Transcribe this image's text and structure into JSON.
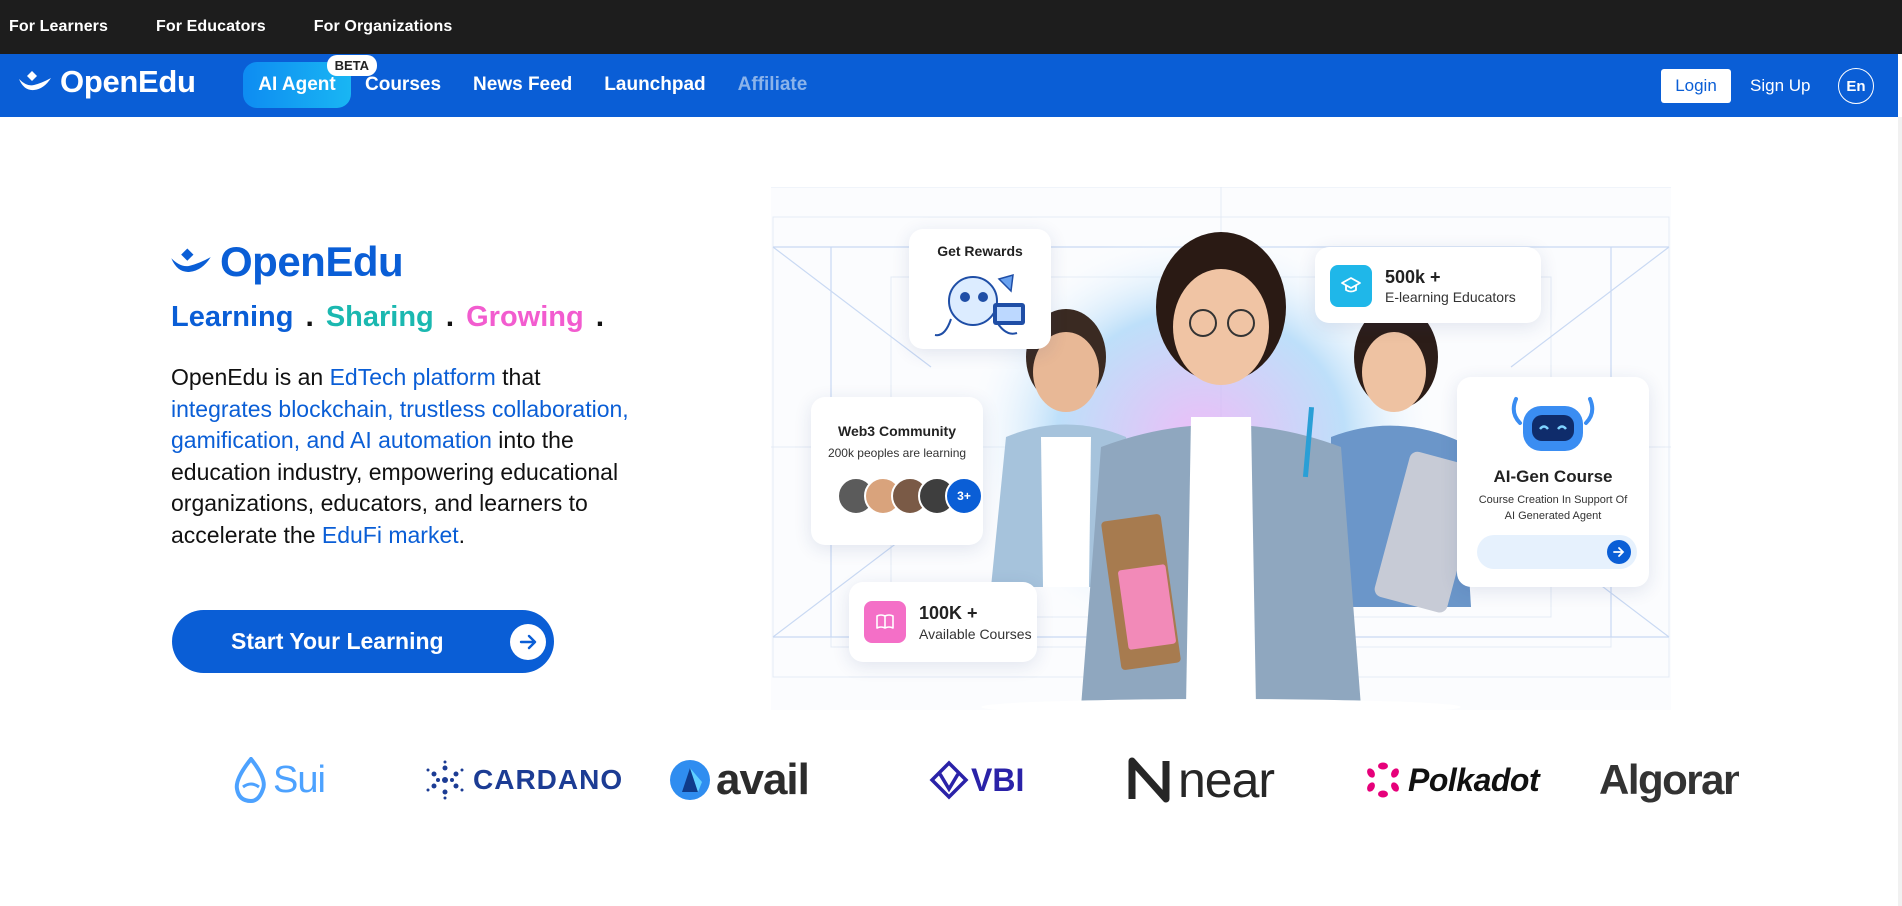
{
  "topbar": {
    "links": [
      "For Learners",
      "For Educators",
      "For Organizations"
    ]
  },
  "nav": {
    "brand": "OpenEdu",
    "ai_agent": "AI Agent",
    "beta": "BETA",
    "links": [
      "Courses",
      "News Feed",
      "Launchpad",
      "Affiliate"
    ],
    "login": "Login",
    "signup": "Sign Up",
    "language": "En"
  },
  "hero": {
    "brand": "OpenEdu",
    "tagline": [
      "Learning",
      "Sharing",
      "Growing"
    ],
    "tagline_dot": ".",
    "description": {
      "p1": "OpenEdu is an ",
      "h1": "EdTech platform",
      "p2": " that ",
      "h2": "integrates blockchain, trustless collaboration, gamification, and AI automation",
      "p3": " into the education industry, empowering educational organizations, educators, and learners to accelerate the ",
      "h3": "EduFi market",
      "p4": "."
    },
    "cta": "Start Your Learning"
  },
  "illustration": {
    "rewards": "Get Rewards",
    "community_title": "Web3 Community",
    "community_sub": "200k peoples are learning",
    "community_more": "3+",
    "educators_count": "500k +",
    "educators_label": "E-learning Educators",
    "courses_count": "100K +",
    "courses_label": "Available Courses",
    "aigen_title": "AI-Gen Course",
    "aigen_sub": "Course Creation In Support Of AI Generated Agent"
  },
  "partners": [
    "Sui",
    "CARDANO",
    "avail",
    "VBI",
    "near",
    "Polkadot",
    "Algorand"
  ],
  "colors": {
    "brand_blue": "#0a5ed6",
    "teal": "#1bb8b0",
    "pink": "#f25ccf",
    "topbar": "#1d1d1d"
  }
}
